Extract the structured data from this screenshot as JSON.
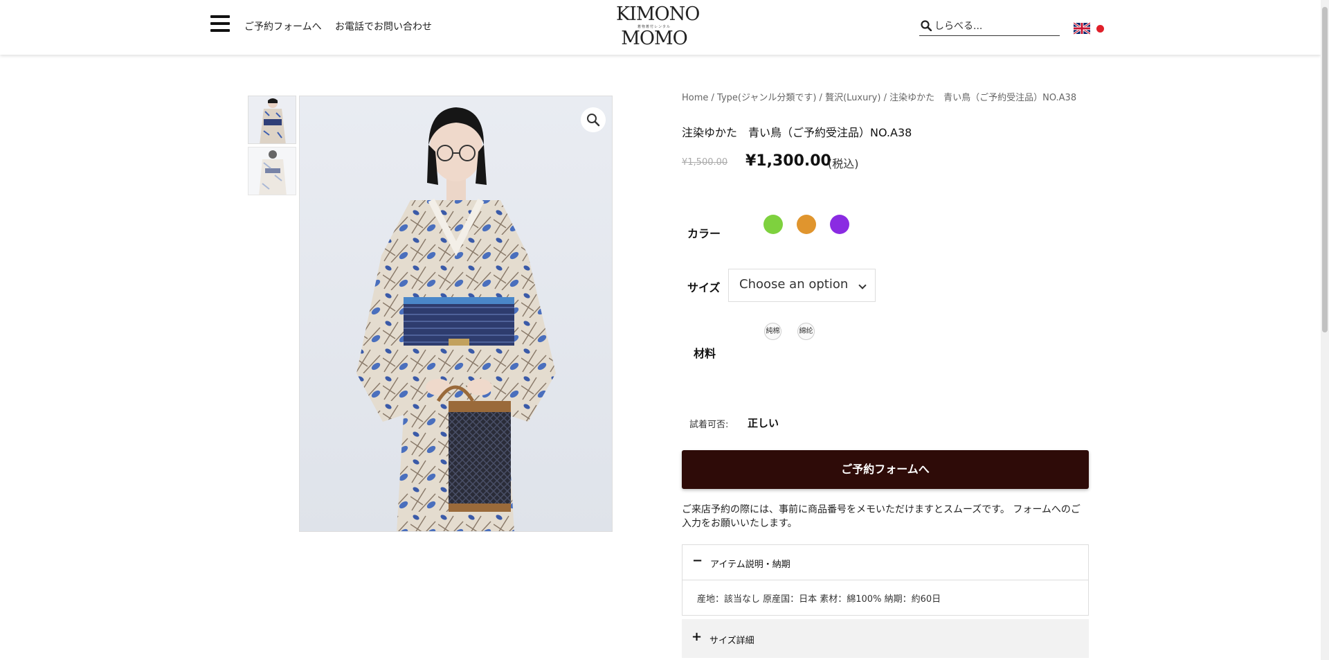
{
  "header": {
    "nav": [
      "ご予約フォームへ",
      "お電話でお問い合わせ"
    ],
    "logo_top": "KIMONO",
    "logo_tagline": "着物着付レンタル",
    "logo_bottom": "MOMO",
    "search_placeholder": "しらべる..."
  },
  "gallery": {
    "thumbnails": [
      "thumbnail-1",
      "thumbnail-2"
    ],
    "zoom_icon": "magnifier-icon"
  },
  "product": {
    "breadcrumb": [
      "Home",
      "Type(ジャンル分類です)",
      "贅沢(Luxury)",
      "注染ゆかた　青い鳥（ご予約受注品）NO.A38"
    ],
    "breadcrumb_sep": " / ",
    "title": "注染ゆかた　青い鳥（ご予約受注品）NO.A38",
    "price_old": "¥1,500.00",
    "price_new": "¥1,300.00",
    "price_tax": "(税込)",
    "color_label": "カラー",
    "colors": [
      "#7ed13e",
      "#e0952e",
      "#8a2be2"
    ],
    "size_label": "サイズ",
    "size_select": "Choose an option",
    "material_label": "材料",
    "materials": [
      "純棉",
      "綿纶"
    ],
    "tryon_label": "試着可否:",
    "tryon_value": "正しい",
    "reserve_button": "ご予約フォームへ",
    "note": "ご来店予約の際には、事前に商品番号をメモいただけますとスムーズです。 フォームへのご入力をお願いいたします。"
  },
  "accordion": [
    {
      "title": "アイテム説明・納期",
      "sign": "−",
      "body": "産地：該当なし 原産国：日本 素材：綿100% 納期：約60日"
    },
    {
      "title": "サイズ詳細",
      "sign": "+"
    }
  ],
  "colors": {
    "button_bg": "#2e0b08",
    "lang_dot": "#e0202a"
  }
}
